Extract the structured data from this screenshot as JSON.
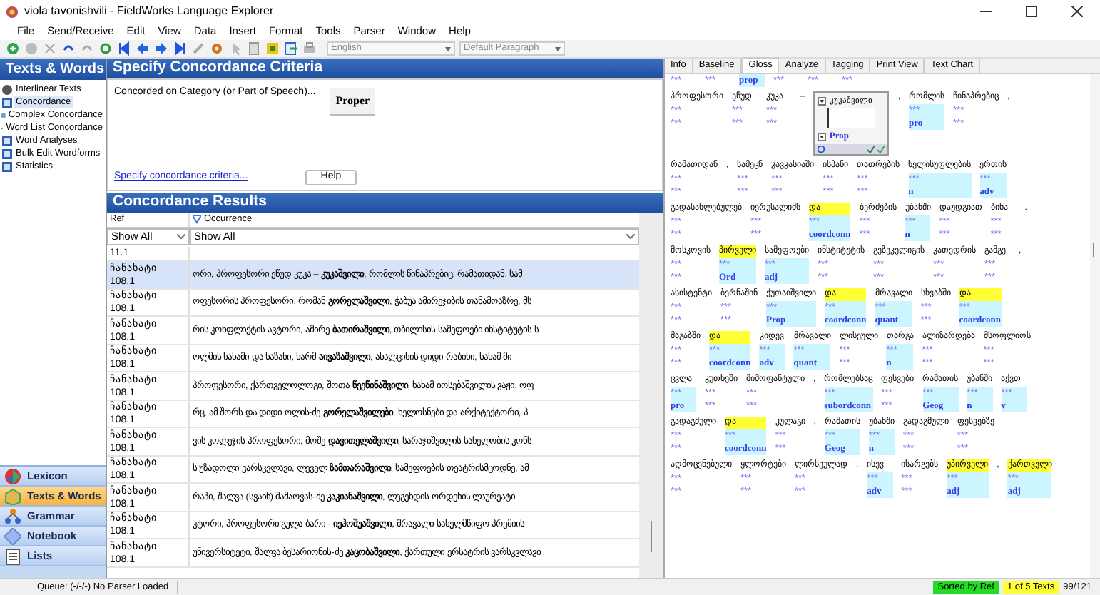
{
  "window": {
    "title": "viola tavonishvili - FieldWorks Language Explorer"
  },
  "menu": [
    "File",
    "Send/Receive",
    "Edit",
    "View",
    "Data",
    "Insert",
    "Format",
    "Tools",
    "Parser",
    "Window",
    "Help"
  ],
  "toolbar": {
    "writing_system": "English",
    "style": "Default Paragraph"
  },
  "sidebar": {
    "title": "Texts & Words",
    "items": [
      {
        "label": "Interlinear Texts",
        "selected": false
      },
      {
        "label": "Concordance",
        "selected": true
      },
      {
        "label": "Complex Concordance",
        "selected": false
      },
      {
        "label": "Word List Concordance",
        "selected": false
      },
      {
        "label": "Word Analyses",
        "selected": false
      },
      {
        "label": "Bulk Edit Wordforms",
        "selected": false
      },
      {
        "label": "Statistics",
        "selected": false
      }
    ]
  },
  "areas": [
    {
      "label": "Lexicon",
      "selected": false
    },
    {
      "label": "Texts & Words",
      "selected": true
    },
    {
      "label": "Grammar",
      "selected": false
    },
    {
      "label": "Notebook",
      "selected": false
    },
    {
      "label": "Lists",
      "selected": false
    }
  ],
  "criteria": {
    "title": "Specify Concordance Criteria",
    "label": "Concorded on Category (or Part of Speech)...",
    "value": "Proper",
    "link": "Specify concordance criteria...",
    "help": "Help"
  },
  "results": {
    "title": "Concordance Results",
    "columns": [
      {
        "label": "Ref",
        "filter": "Show All",
        "sorted": false
      },
      {
        "label": "Occurrence",
        "filter": "Show All",
        "sorted": true
      }
    ],
    "rows": [
      {
        "ref": [
          "11.1"
        ],
        "before": "",
        "keyword": "",
        "after": "",
        "selected": false
      },
      {
        "ref": [
          "ჩანახატი",
          "108.1"
        ],
        "before": "ორი, პროფესორი ეწუდ კუკა – ",
        "keyword": "კუკაშვილი",
        "after": ", რომლის წინაპრებიც, რამათიდან, სამ",
        "selected": true
      },
      {
        "ref": [
          "ჩანახატი",
          "108.1"
        ],
        "before": "ოფესორის პროფესორი, რომან ",
        "keyword": "გორელაშვილი",
        "after": ", ჭაბუა ამირეჯიბის თანამოაზრე, მს",
        "selected": false
      },
      {
        "ref": [
          "ჩანახატი",
          "108.1"
        ],
        "before": "რის კონფლიქტის ავტორი, ამირე ",
        "keyword": "ბათირაშვილი",
        "after": ", თბილისის სამეფოები ინსტიტუტის ს",
        "selected": false
      },
      {
        "ref": [
          "ჩანახატი",
          "108.1"
        ],
        "before": "ოლმის ხახამი და ხაზანი, ხარმ ",
        "keyword": "აივაზაშვილი",
        "after": ", ახალციხის დიდი რაბინი, ხახამ მი",
        "selected": false
      },
      {
        "ref": [
          "ჩანახატი",
          "108.1"
        ],
        "before": "პროფესორი, ქართველოლოგი, შოთა ",
        "keyword": "წეეწინაშვილი",
        "after": ", ხახამ იოსებაშვილის ვაჟი, ოფ",
        "selected": false
      },
      {
        "ref": [
          "ჩანახატი",
          "108.1"
        ],
        "before": "რც, ამ შორს და დიდი ოლის-ძე ",
        "keyword": "გორელაშვილები",
        "after": ", ხელოსნები და არქიტექტორი, პ",
        "selected": false
      },
      {
        "ref": [
          "ჩანახატი",
          "108.1"
        ],
        "before": "ვის კოლეჯის პროფესორი, მოშე ",
        "keyword": "დავითელაშვილი",
        "after": ", სარაჯიშვილის სახელობის კონს",
        "selected": false
      },
      {
        "ref": [
          "ჩანახატი",
          "108.1"
        ],
        "before": "ს უზადოლი ვარსკვლავი, ლეველ ",
        "keyword": "ზამთარაშვილი",
        "after": ", სამეფოების თეატრისმცოდნე, ამ",
        "selected": false
      },
      {
        "ref": [
          "ჩანახატი",
          "108.1"
        ],
        "before": "რაპი, შალვა (სვაინ) შამაოვას-ძე ",
        "keyword": "კაკიანაშვილი",
        "after": ", ლეგენდის ორდენის ლაურეატი",
        "selected": false
      },
      {
        "ref": [
          "ჩანახატი",
          "108.1"
        ],
        "before": "კტორი, პროფესორი გულა ბარი - ",
        "keyword": "იეჰოშუაშვილი",
        "after": ", მრავალი სახელმწიფო პრემიის",
        "selected": false
      },
      {
        "ref": [
          "ჩანახატი",
          "108.1"
        ],
        "before": "უნივერსიტეტი, შალვა ბესარიონის-ძე ",
        "keyword": "კაცობაშვილი",
        "after": ", ქართული ერსატრის ვარსკვლავი",
        "selected": false
      }
    ]
  },
  "tabs": [
    {
      "label": "Info",
      "selected": false
    },
    {
      "label": "Baseline",
      "selected": false
    },
    {
      "label": "Gloss",
      "selected": true
    },
    {
      "label": "Analyze",
      "selected": false
    },
    {
      "label": "Tagging",
      "selected": false
    },
    {
      "label": "Print View",
      "selected": false
    },
    {
      "label": "Text Chart",
      "selected": false
    }
  ],
  "interlinear": [
    {
      "words": [
        {
          "cat": "***",
          "analyzed": false
        },
        {
          "cat": "***",
          "analyzed": false
        },
        {
          "cat": "prop",
          "analyzed": true
        },
        {
          "cat": "***",
          "analyzed": false
        },
        {
          "cat": "***",
          "analyzed": false
        },
        {
          "cat": "***",
          "analyzed": false
        }
      ]
    },
    {
      "words": [
        {
          "word": "პროფესორი",
          "gloss": "***",
          "cat": "***",
          "analyzed": false,
          "highlight": false
        },
        {
          "word": "ეწუდ",
          "gloss": "***",
          "cat": "***",
          "analyzed": false,
          "highlight": false
        },
        {
          "word": "კუკა",
          "gloss": "***",
          "cat": "***",
          "analyzed": false,
          "highlight": false
        },
        {
          "word": "–",
          "kind": "punct"
        },
        {
          "kind": "editor",
          "word": "კუკაშვილი",
          "cat": "Prop"
        },
        {
          "word": ",",
          "kind": "punct"
        },
        {
          "word": "რომლის",
          "gloss": "***",
          "cat": "pro",
          "analyzed": true,
          "highlight": false
        },
        {
          "word": "წინაპრებიც",
          "gloss": "***",
          "cat": "***",
          "analyzed": false,
          "highlight": false
        },
        {
          "word": ",",
          "kind": "punct"
        }
      ]
    },
    {
      "words": [
        {
          "word": "რამათიდან",
          "gloss": "***",
          "cat": "***",
          "analyzed": false,
          "highlight": false
        },
        {
          "word": ",",
          "kind": "punct"
        },
        {
          "word": "სამეცნ",
          "gloss": "***",
          "cat": "***",
          "analyzed": false,
          "highlight": false
        },
        {
          "word": "კავკასიაში",
          "gloss": "***",
          "cat": "***",
          "analyzed": false,
          "highlight": false
        },
        {
          "word": "ისპანი",
          "gloss": "***",
          "cat": "***",
          "analyzed": false,
          "highlight": false
        },
        {
          "word": "თათრების",
          "gloss": "***",
          "cat": "***",
          "analyzed": false,
          "highlight": false
        },
        {
          "word": "ხელისუფლების",
          "gloss": "***",
          "cat": "n",
          "analyzed": true,
          "highlight": false
        },
        {
          "word": "ერთის",
          "gloss": "***",
          "cat": "adv",
          "analyzed": true,
          "highlight": false
        }
      ]
    },
    {
      "words": [
        {
          "word": "გადასახლებულებ",
          "gloss": "***",
          "cat": "***",
          "analyzed": false,
          "highlight": false
        },
        {
          "word": "იერუსალიმს",
          "gloss": "***",
          "cat": "***",
          "analyzed": false,
          "highlight": false
        },
        {
          "word": "და",
          "gloss": "***",
          "cat": "coordconn",
          "analyzed": true,
          "highlight": true
        },
        {
          "word": "ბერძების",
          "gloss": "***",
          "cat": "***",
          "analyzed": false,
          "highlight": false
        },
        {
          "word": "უბანში",
          "gloss": "***",
          "cat": "n",
          "analyzed": true,
          "highlight": false
        },
        {
          "word": "დაუდგიათ",
          "gloss": "***",
          "cat": "***",
          "analyzed": false,
          "highlight": false
        },
        {
          "word": "ბინა",
          "gloss": "***",
          "cat": "***",
          "analyzed": false,
          "highlight": false
        },
        {
          "word": ".",
          "kind": "punct"
        }
      ]
    },
    {
      "words": [
        {
          "word": "მოსკოვის",
          "gloss": "***",
          "cat": "***",
          "analyzed": false,
          "highlight": false
        },
        {
          "word": "პირველი",
          "gloss": "***",
          "cat": "Ord",
          "analyzed": true,
          "highlight": true
        },
        {
          "word": "სამეფოები",
          "gloss": "***",
          "cat": "adj",
          "analyzed": true,
          "highlight": false
        },
        {
          "word": "ინსტიტუტის",
          "gloss": "***",
          "cat": "***",
          "analyzed": false,
          "highlight": false
        },
        {
          "word": "გეზეკელიგის",
          "gloss": "***",
          "cat": "***",
          "analyzed": false,
          "highlight": false
        },
        {
          "word": "კათედრის",
          "gloss": "***",
          "cat": "***",
          "analyzed": false,
          "highlight": false
        },
        {
          "word": "გამგე",
          "gloss": "***",
          "cat": "***",
          "analyzed": false,
          "highlight": false
        },
        {
          "word": ",",
          "kind": "punct"
        }
      ]
    },
    {
      "words": [
        {
          "word": "ასისტენტი",
          "gloss": "***",
          "cat": "***",
          "analyzed": false,
          "highlight": false
        },
        {
          "word": "ბერნაშინ",
          "gloss": "***",
          "cat": "***",
          "analyzed": false,
          "highlight": false
        },
        {
          "word": "ქუთაიშვილი",
          "gloss": "***",
          "cat": "Prop",
          "analyzed": true,
          "highlight": false
        },
        {
          "word": "და",
          "gloss": "***",
          "cat": "coordconn",
          "analyzed": true,
          "highlight": true
        },
        {
          "word": "მრავალი",
          "gloss": "***",
          "cat": "quant",
          "analyzed": true,
          "highlight": false
        },
        {
          "word": "სხვაბში",
          "gloss": "***",
          "cat": "***",
          "analyzed": false,
          "highlight": false
        },
        {
          "word": "და",
          "gloss": "***",
          "cat": "coordconn",
          "analyzed": true,
          "highlight": true
        }
      ]
    },
    {
      "words": [
        {
          "word": "მაგაბში",
          "gloss": "***",
          "cat": "***",
          "analyzed": false,
          "highlight": false
        },
        {
          "word": "და",
          "gloss": "***",
          "cat": "coordconn",
          "analyzed": true,
          "highlight": true
        },
        {
          "word": "კიდევ",
          "gloss": "***",
          "cat": "adv",
          "analyzed": true,
          "highlight": false
        },
        {
          "word": "მრავალი",
          "gloss": "***",
          "cat": "quant",
          "analyzed": true,
          "highlight": false
        },
        {
          "word": "ლისეული",
          "gloss": "***",
          "cat": "***",
          "analyzed": false,
          "highlight": false
        },
        {
          "word": "თარგა",
          "gloss": "***",
          "cat": "n",
          "analyzed": true,
          "highlight": false
        },
        {
          "word": "ალიზარდება",
          "gloss": "***",
          "cat": "***",
          "analyzed": false,
          "highlight": false
        },
        {
          "word": "მსოფლიოს",
          "gloss": "***",
          "cat": "***",
          "analyzed": false,
          "highlight": false
        }
      ]
    },
    {
      "words": [
        {
          "word": "ცვლა",
          "gloss": "***",
          "cat": "pro",
          "analyzed": true,
          "highlight": false
        },
        {
          "word": "კუთხეში",
          "gloss": "***",
          "cat": "***",
          "analyzed": false,
          "highlight": false
        },
        {
          "word": "მიმოფანტული",
          "gloss": "***",
          "cat": "***",
          "analyzed": false,
          "highlight": false
        },
        {
          "word": ",",
          "kind": "punct"
        },
        {
          "word": "რომლებსაც",
          "gloss": "***",
          "cat": "subordconn",
          "analyzed": true,
          "highlight": false
        },
        {
          "word": "ფესვები",
          "gloss": "***",
          "cat": "***",
          "analyzed": false,
          "highlight": false
        },
        {
          "word": "რამათის",
          "gloss": "***",
          "cat": "Geog",
          "analyzed": true,
          "highlight": false
        },
        {
          "word": "უბანში",
          "gloss": "***",
          "cat": "n",
          "analyzed": true,
          "highlight": false
        },
        {
          "word": "აქვთ",
          "gloss": "***",
          "cat": "v",
          "analyzed": true,
          "highlight": false
        }
      ]
    },
    {
      "words": [
        {
          "word": "გადაგმული",
          "gloss": "***",
          "cat": "***",
          "analyzed": false,
          "highlight": false
        },
        {
          "word": "და",
          "gloss": "***",
          "cat": "coordconn",
          "analyzed": true,
          "highlight": true
        },
        {
          "word": "კულაგი",
          "gloss": "***",
          "cat": "***",
          "analyzed": false,
          "highlight": false
        },
        {
          "word": ",",
          "kind": "punct"
        },
        {
          "word": "რამათის",
          "gloss": "***",
          "cat": "Geog",
          "analyzed": true,
          "highlight": false
        },
        {
          "word": "უბანში",
          "gloss": "***",
          "cat": "n",
          "analyzed": true,
          "highlight": false
        },
        {
          "word": "გადაგმული",
          "gloss": "***",
          "cat": "***",
          "analyzed": false,
          "highlight": false
        },
        {
          "word": "ფესვებზე",
          "gloss": "***",
          "cat": "***",
          "analyzed": false,
          "highlight": false
        }
      ]
    },
    {
      "words": [
        {
          "word": "აღმოცენებული",
          "gloss": "***",
          "cat": "***",
          "analyzed": false,
          "highlight": false
        },
        {
          "word": "ყლორტები",
          "gloss": "***",
          "cat": "***",
          "analyzed": false,
          "highlight": false
        },
        {
          "word": "ლირსეულად",
          "gloss": "***",
          "cat": "***",
          "analyzed": false,
          "highlight": false
        },
        {
          "word": ",",
          "kind": "punct"
        },
        {
          "word": "ისევ",
          "gloss": "***",
          "cat": "adv",
          "analyzed": true,
          "highlight": false
        },
        {
          "word": "ისარგებს",
          "gloss": "***",
          "cat": "***",
          "analyzed": false,
          "highlight": false
        },
        {
          "word": "უპირველი",
          "gloss": "***",
          "cat": "adj",
          "analyzed": true,
          "highlight": true
        },
        {
          "word": ",",
          "kind": "punct"
        },
        {
          "word": "ქართველი",
          "gloss": "***",
          "cat": "adj",
          "analyzed": true,
          "highlight": true
        }
      ]
    }
  ],
  "status_bar": {
    "queue": "Queue: (-/-/-) No Parser Loaded",
    "sort": "Sorted by Ref",
    "texts": "1 of 5 Texts",
    "position": "99/121"
  }
}
